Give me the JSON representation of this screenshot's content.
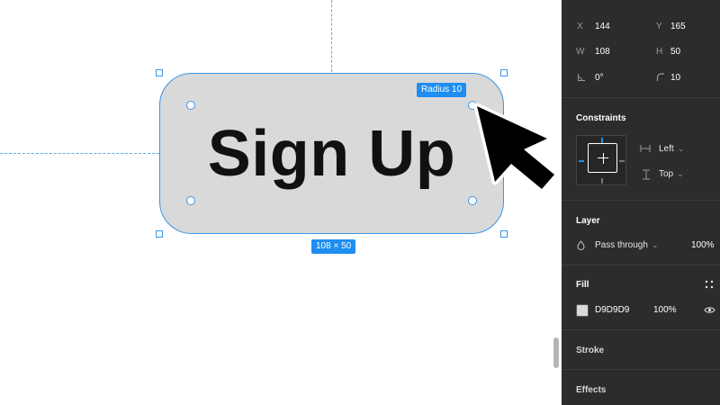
{
  "canvas": {
    "button_label": "Sign Up",
    "radius_badge": "Radius 10",
    "size_badge": "108 × 50",
    "accent_color": "#1e8ef0",
    "fill_color": "#d9d9d9"
  },
  "panel": {
    "position": {
      "x_label": "X",
      "x_value": "144",
      "y_label": "Y",
      "y_value": "165"
    },
    "size": {
      "w_label": "W",
      "w_value": "108",
      "h_label": "H",
      "h_value": "50"
    },
    "rotation_value": "0°",
    "radius_value": "10",
    "constraints": {
      "title": "Constraints",
      "horizontal": "Left",
      "vertical": "Top"
    },
    "layer": {
      "title": "Layer",
      "blend_mode": "Pass through",
      "opacity": "100%"
    },
    "fill": {
      "title": "Fill",
      "hex": "D9D9D9",
      "opacity": "100%"
    },
    "stroke": {
      "title": "Stroke"
    },
    "effects": {
      "title": "Effects"
    }
  },
  "icons": [
    "rotation-icon",
    "corner-radius-icon",
    "horizontal-constraint-icon",
    "vertical-constraint-icon",
    "opacity-drop-icon",
    "chevron-down-icon",
    "styles-grid-icon",
    "eye-icon",
    "cursor-arrow-icon"
  ]
}
